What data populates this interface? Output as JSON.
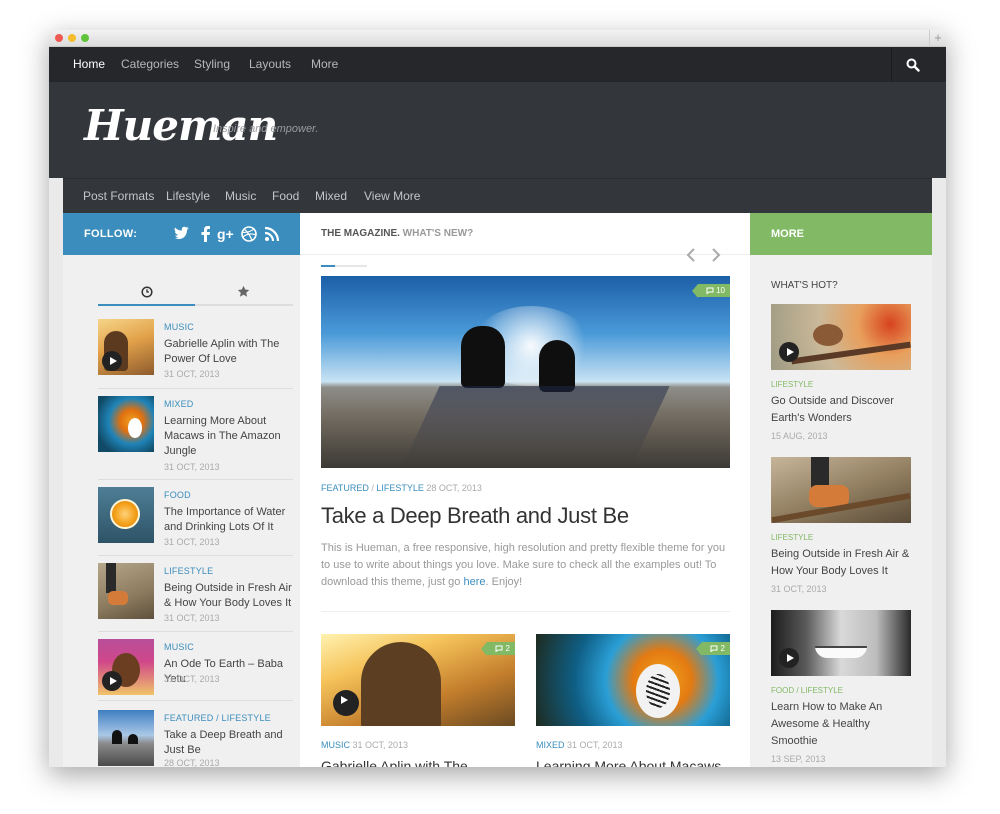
{
  "topnav": {
    "items": [
      "Home",
      "Categories",
      "Styling",
      "Layouts",
      "More"
    ]
  },
  "header": {
    "logo": "Hueman",
    "tagline": "Inspire and empower."
  },
  "subnav": {
    "items": [
      "Post Formats",
      "Lifestyle",
      "Music",
      "Food",
      "Mixed",
      "View More"
    ]
  },
  "left": {
    "follow_label": "FOLLOW:",
    "social_icons": [
      "twitter-icon",
      "facebook-icon",
      "google-plus-icon",
      "dribbble-icon",
      "rss-icon"
    ],
    "tabs": [
      "clock-icon",
      "star-icon"
    ],
    "posts": [
      {
        "category": "MUSIC",
        "title": "Gabrielle Aplin with The Power Of Love",
        "date": "31 OCT, 2013"
      },
      {
        "category": "MIXED",
        "title": "Learning More About Macaws in The Amazon Jungle",
        "date": "31 OCT, 2013"
      },
      {
        "category": "FOOD",
        "title": "The Importance of Water and Drinking Lots Of It",
        "date": "31 OCT, 2013"
      },
      {
        "category": "LIFESTYLE",
        "title": "Being Outside in Fresh Air & How Your Body Loves It",
        "date": "31 OCT, 2013"
      },
      {
        "category": "MUSIC",
        "title": "An Ode To Earth – Baba Yetu",
        "date": "31 OCT, 2013"
      },
      {
        "category": "FEATURED / LIFESTYLE",
        "title": "Take a Deep Breath and Just Be",
        "date": "28 OCT, 2013"
      }
    ]
  },
  "main": {
    "heading": "THE MAGAZINE.",
    "heading_sub": "WHAT'S NEW?",
    "featured": {
      "comments": "10",
      "cat1": "FEATURED",
      "cat_sep": " / ",
      "cat2": "LIFESTYLE",
      "date": "28 OCT, 2013",
      "title": "Take a Deep Breath and Just Be",
      "excerpt": "This is Hueman, a free responsive, high resolution and pretty flexible theme for you to use to write about things you love. Make sure to check all the examples out! To download this theme, just go",
      "link": "here",
      "after_link": ". Enjoy!"
    },
    "cards": [
      {
        "comments": "2",
        "category": "MUSIC",
        "date": "31 OCT, 2013",
        "title": "Gabrielle Aplin with The"
      },
      {
        "comments": "2",
        "category": "MIXED",
        "date": "31 OCT, 2013",
        "title": "Learning More About Macaws"
      }
    ]
  },
  "right": {
    "more_label": "MORE",
    "hot_label": "WHAT'S HOT?",
    "posts": [
      {
        "category": "LIFESTYLE",
        "title": "Go Outside and Discover Earth's Wonders",
        "date": "15 AUG, 2013"
      },
      {
        "category": "LIFESTYLE",
        "title": "Being Outside in Fresh Air & How Your Body Loves It",
        "date": "31 OCT, 2013"
      },
      {
        "category": "FOOD / LIFESTYLE",
        "title": "Learn How to Make An Awesome & Healthy Smoothie",
        "date": "13 SEP, 2013"
      }
    ]
  },
  "colors": {
    "accent_blue": "#3b8dbd",
    "accent_green": "#82b965",
    "dark_bg": "#33363b"
  }
}
